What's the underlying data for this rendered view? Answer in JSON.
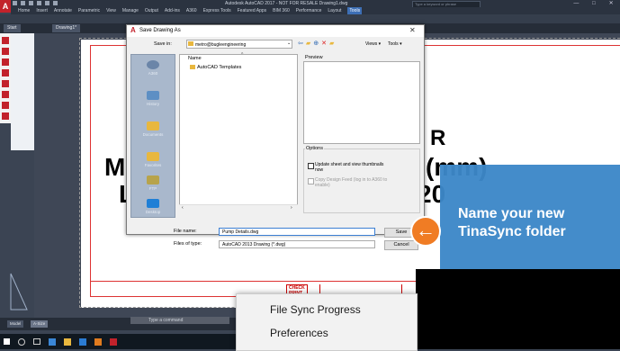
{
  "app": {
    "title": "Autodesk AutoCAD 2017 - NOT FOR RESALE   Drawing1.dwg",
    "logo_letter": "A",
    "search_placeholder": "Type a keyword or phrase",
    "sign_in": "Sign In"
  },
  "menubar": [
    "Home",
    "Insert",
    "Annotate",
    "Parametric",
    "View",
    "Manage",
    "Output",
    "Add-ins",
    "A360",
    "Express Tools",
    "Featured Apps",
    "BIM 360",
    "Performance",
    "Layout",
    "Tools"
  ],
  "menubar_active": "Tools",
  "doc_tabs": [
    "Start",
    "Drawing1*"
  ],
  "drawing": {
    "text_left_1": "M",
    "text_left_2": "L",
    "text_right_1": "R",
    "text_right_2": "(mm)",
    "text_right_3": "20",
    "check_print": "CHECK\nPRINT"
  },
  "layout_tabs": [
    "Model",
    "A-Size"
  ],
  "cmdline_placeholder": "Type a command",
  "dialog": {
    "title": "Save Drawing As",
    "save_in_label": "Save in:",
    "save_in_value": "metro@bugleengineering",
    "views_label": "Views",
    "tools_label": "Tools",
    "places": [
      "A360",
      "History",
      "Documents",
      "Favorites",
      "FTP",
      "Desktop"
    ],
    "name_column": "Name",
    "files": [
      "AutoCAD Templates"
    ],
    "preview_label": "Preview",
    "options_label": "Options",
    "opt_update_thumbnails": "Update sheet and view thumbnails now",
    "opt_copy_design_feed": "Copy Design Feed (log in to A360 to enable)",
    "file_name_label": "File name:",
    "file_name_value": "Pump Details.dwg",
    "file_type_label": "Files of type:",
    "file_type_value": "AutoCAD 2013 Drawing (*.dwg)",
    "save_button": "Save",
    "cancel_button": "Cancel"
  },
  "tip": {
    "line1": "Name your new",
    "line2": "TinaSync folder"
  },
  "context_menu": {
    "items": [
      "File Sync Progress",
      "Preferences"
    ]
  }
}
